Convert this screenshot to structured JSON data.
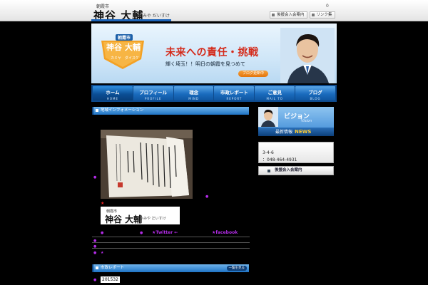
{
  "header": {
    "city": "朝霞市",
    "name": "神谷 大輔",
    "kana": "かみや だいすけ",
    "page_count": "0",
    "links": [
      "後援会入会案内",
      "リンク集"
    ]
  },
  "banner": {
    "badge_city": "朝霞市",
    "badge_name": "神谷 大輔",
    "badge_kana": "カミヤ　ダイスケ",
    "headline": "未来への責任・挑戦",
    "subline": "輝く埼玉！！明日の朝霞を見つめて",
    "update_button": "ブログ更新中"
  },
  "nav": [
    {
      "jp": "ホーム",
      "en": "HOME"
    },
    {
      "jp": "プロフィール",
      "en": "PROFILE"
    },
    {
      "jp": "理念",
      "en": "MIND"
    },
    {
      "jp": "市政レポート",
      "en": "REPORT"
    },
    {
      "jp": "ご意見",
      "en": "MAIL TO"
    },
    {
      "jp": "ブログ",
      "en": "BLOG"
    }
  ],
  "main": {
    "section1_title": "地域インフォメーション",
    "mini_logo": {
      "city": "朝霞市",
      "name": "神谷 大輔",
      "kana": "かみや だいすけ"
    },
    "star": "★",
    "twitter": "★Twitter ←",
    "facebook": "★facebook",
    "section2_title": "市政レポート",
    "section2_more": "一覧を見る",
    "date": "201532"
  },
  "sidebar": {
    "vision_title": "ビジョン",
    "vision_en": "Vision",
    "news_jp": "最新情報",
    "news_en": "NEWS",
    "address": "3-4-6",
    "tel": "：048-464-4931",
    "support": "後援会入会案内"
  },
  "colors": {
    "accent": "#1b63b8",
    "headline_red": "#d42a1a",
    "link_purple": "#b22ce6"
  }
}
